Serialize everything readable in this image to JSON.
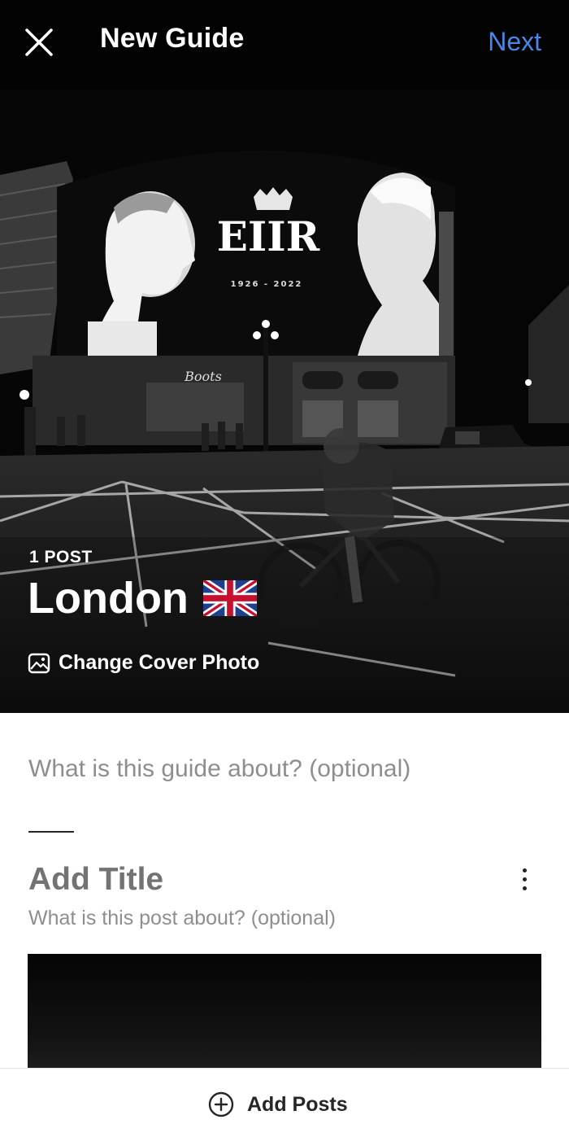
{
  "header": {
    "title": "New Guide",
    "next_label": "Next"
  },
  "cover": {
    "post_count": "1 POST",
    "guide_title": "London",
    "change_cover_label": "Change Cover Photo",
    "screen_text": {
      "monogram": "EIIR",
      "years": "1926 - 2022",
      "store": "Boots"
    }
  },
  "guide": {
    "description_placeholder": "What is this guide about? (optional)"
  },
  "post": {
    "title_placeholder": "Add Title",
    "description_placeholder": "What is this post about? (optional)"
  },
  "footer": {
    "add_posts_label": "Add Posts"
  },
  "colors": {
    "accent": "#4a86e8",
    "placeholder": "#8e8e8e"
  }
}
